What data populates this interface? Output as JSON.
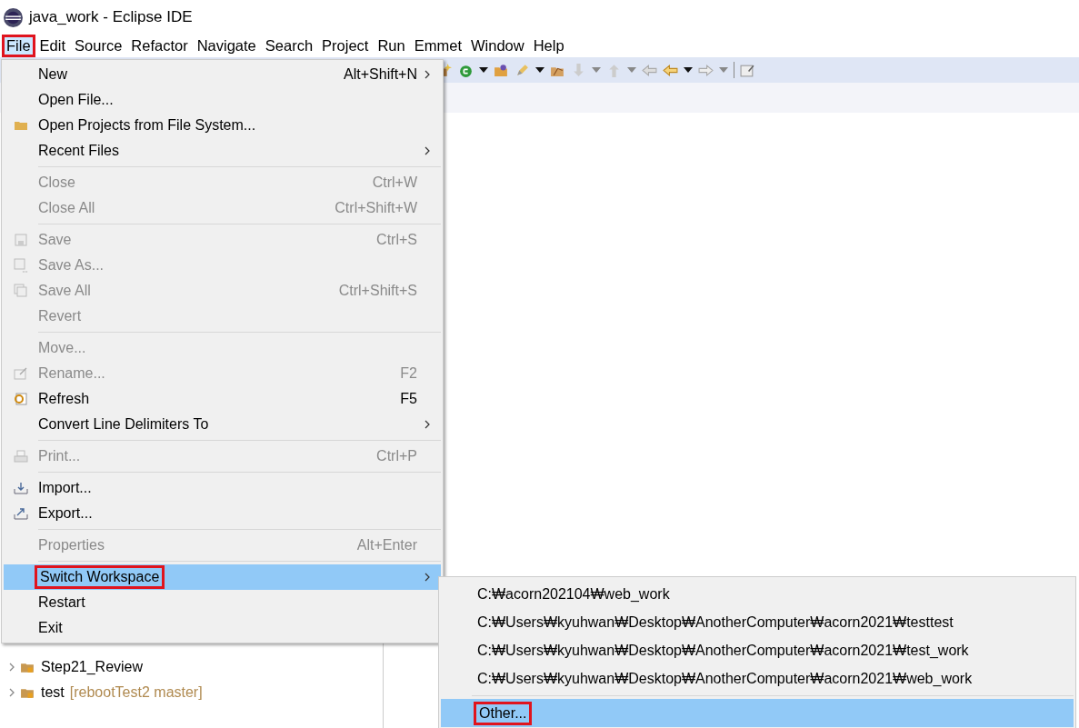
{
  "window": {
    "title": "java_work - Eclipse IDE"
  },
  "menubar": [
    {
      "label": "File",
      "selected": true,
      "highlighted": true
    },
    {
      "label": "Edit",
      "selected": false,
      "highlighted": false
    },
    {
      "label": "Source",
      "selected": false,
      "highlighted": false
    },
    {
      "label": "Refactor",
      "selected": false,
      "highlighted": false
    },
    {
      "label": "Navigate",
      "selected": false,
      "highlighted": false
    },
    {
      "label": "Search",
      "selected": false,
      "highlighted": false
    },
    {
      "label": "Project",
      "selected": false,
      "highlighted": false
    },
    {
      "label": "Run",
      "selected": false,
      "highlighted": false
    },
    {
      "label": "Emmet",
      "selected": false,
      "highlighted": false
    },
    {
      "label": "Window",
      "selected": false,
      "highlighted": false
    },
    {
      "label": "Help",
      "selected": false,
      "highlighted": false
    }
  ],
  "file_menu": [
    [
      {
        "label": "New",
        "shortcut": "Alt+Shift+N",
        "submenu": true,
        "disabled": false,
        "selected": false,
        "highlighted": false
      },
      {
        "label": "Open File...",
        "submenu": false,
        "disabled": false,
        "selected": false,
        "highlighted": false
      },
      {
        "label": "Open Projects from File System...",
        "submenu": false,
        "disabled": false,
        "selected": false,
        "highlighted": false
      },
      {
        "label": "Recent Files",
        "submenu": true,
        "disabled": false,
        "selected": false,
        "highlighted": false
      }
    ],
    [
      {
        "label": "Close",
        "shortcut": "Ctrl+W",
        "submenu": false,
        "disabled": true,
        "selected": false,
        "highlighted": false
      },
      {
        "label": "Close All",
        "shortcut": "Ctrl+Shift+W",
        "submenu": false,
        "disabled": true,
        "selected": false,
        "highlighted": false
      }
    ],
    [
      {
        "label": "Save",
        "shortcut": "Ctrl+S",
        "submenu": false,
        "disabled": true,
        "selected": false,
        "highlighted": false
      },
      {
        "label": "Save As...",
        "submenu": false,
        "disabled": true,
        "selected": false,
        "highlighted": false
      },
      {
        "label": "Save All",
        "shortcut": "Ctrl+Shift+S",
        "submenu": false,
        "disabled": true,
        "selected": false,
        "highlighted": false
      },
      {
        "label": "Revert",
        "submenu": false,
        "disabled": true,
        "selected": false,
        "highlighted": false
      }
    ],
    [
      {
        "label": "Move...",
        "submenu": false,
        "disabled": true,
        "selected": false,
        "highlighted": false
      },
      {
        "label": "Rename...",
        "shortcut": "F2",
        "submenu": false,
        "disabled": true,
        "selected": false,
        "highlighted": false
      },
      {
        "label": "Refresh",
        "shortcut": "F5",
        "submenu": false,
        "disabled": false,
        "selected": false,
        "highlighted": false
      },
      {
        "label": "Convert Line Delimiters To",
        "submenu": true,
        "disabled": false,
        "selected": false,
        "highlighted": false
      }
    ],
    [
      {
        "label": "Print...",
        "shortcut": "Ctrl+P",
        "submenu": false,
        "disabled": true,
        "selected": false,
        "highlighted": false
      }
    ],
    [
      {
        "label": "Import...",
        "submenu": false,
        "disabled": false,
        "selected": false,
        "highlighted": false
      },
      {
        "label": "Export...",
        "submenu": false,
        "disabled": false,
        "selected": false,
        "highlighted": false
      }
    ],
    [
      {
        "label": "Properties",
        "shortcut": "Alt+Enter",
        "submenu": false,
        "disabled": true,
        "selected": false,
        "highlighted": false
      }
    ],
    [
      {
        "label": "Switch Workspace",
        "submenu": true,
        "disabled": false,
        "selected": true,
        "highlighted": true
      },
      {
        "label": "Restart",
        "submenu": false,
        "disabled": false,
        "selected": false,
        "highlighted": false
      },
      {
        "label": "Exit",
        "submenu": false,
        "disabled": false,
        "selected": false,
        "highlighted": false
      }
    ]
  ],
  "workspace_submenu": [
    [
      {
        "label": "C:₩acorn202104₩web_work",
        "selected": false,
        "highlighted": false
      },
      {
        "label": "C:₩Users₩kyuhwan₩Desktop₩AnotherComputer₩acorn2021₩testtest",
        "selected": false,
        "highlighted": false
      },
      {
        "label": "C:₩Users₩kyuhwan₩Desktop₩AnotherComputer₩acorn2021₩test_work",
        "selected": false,
        "highlighted": false
      },
      {
        "label": "C:₩Users₩kyuhwan₩Desktop₩AnotherComputer₩acorn2021₩web_work",
        "selected": false,
        "highlighted": false
      }
    ],
    [
      {
        "label": "Other...",
        "selected": true,
        "highlighted": true
      }
    ]
  ],
  "project_tree": [
    {
      "name": "Step21_Review"
    },
    {
      "name": "test",
      "repo": "[rebootTest2 master]"
    }
  ]
}
